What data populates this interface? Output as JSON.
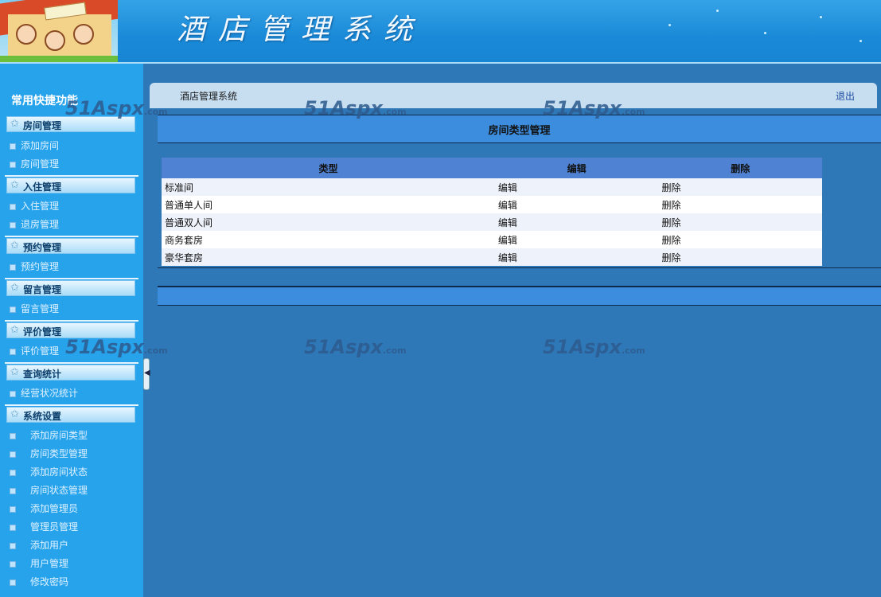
{
  "header": {
    "app_title": "酒店管理系统"
  },
  "sidebar": {
    "quick_title": "常用快捷功能",
    "groups": [
      {
        "label": "房间管理",
        "items": [
          "添加房间",
          "房间管理"
        ]
      },
      {
        "label": "入住管理",
        "items": [
          "入住管理",
          "退房管理"
        ]
      },
      {
        "label": "预约管理",
        "items": [
          "预约管理"
        ]
      },
      {
        "label": "留言管理",
        "items": [
          "留言管理"
        ]
      },
      {
        "label": "评价管理",
        "items": [
          "评价管理"
        ]
      },
      {
        "label": "查询统计",
        "items": [
          "经营状况统计"
        ]
      },
      {
        "label": "系统设置",
        "items": [
          "添加房间类型",
          "房间类型管理",
          "添加房间状态",
          "房间状态管理",
          "添加管理员",
          "管理员管理",
          "添加用户",
          "用户管理",
          "修改密码"
        ]
      }
    ]
  },
  "topbar": {
    "title": "酒店管理系统",
    "logout": "退出"
  },
  "main": {
    "heading": "房间类型管理",
    "table": {
      "headers": [
        "类型",
        "编辑",
        "删除"
      ],
      "rows": [
        [
          "标准间",
          "编辑",
          "删除"
        ],
        [
          "普通单人间",
          "编辑",
          "删除"
        ],
        [
          "普通双人间",
          "编辑",
          "删除"
        ],
        [
          "商务套房",
          "编辑",
          "删除"
        ],
        [
          "豪华套房",
          "编辑",
          "删除"
        ]
      ]
    }
  },
  "watermark": {
    "main": "51Aspx",
    "suffix": ".com"
  },
  "colors": {
    "page_bg": "#2f78b8",
    "sidebar_bg": "#27a3ec",
    "header_bg": "#1a8ad8",
    "table_header": "#4f82d3",
    "band": "#3d8ddf"
  }
}
